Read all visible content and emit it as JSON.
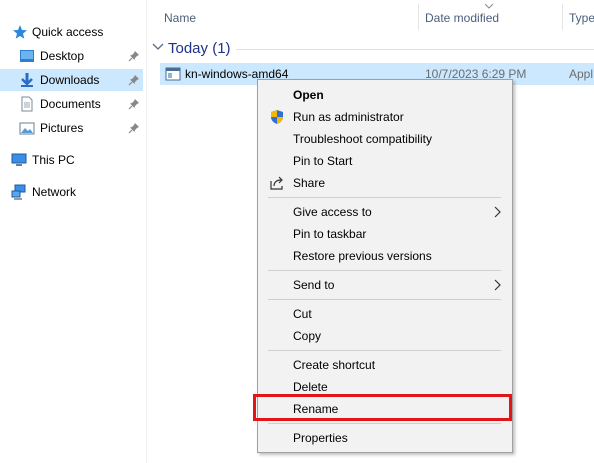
{
  "nav": {
    "items": [
      {
        "label": "Quick access",
        "icon": "star-icon"
      },
      {
        "label": "Desktop",
        "icon": "desktop-folder-icon",
        "pinned": true
      },
      {
        "label": "Downloads",
        "icon": "downloads-folder-icon",
        "pinned": true,
        "selected": true
      },
      {
        "label": "Documents",
        "icon": "documents-folder-icon",
        "pinned": true
      },
      {
        "label": "Pictures",
        "icon": "pictures-folder-icon",
        "pinned": true
      },
      {
        "label": "This PC",
        "icon": "computer-icon"
      },
      {
        "label": "Network",
        "icon": "network-icon"
      }
    ]
  },
  "columns": {
    "name": "Name",
    "date": "Date modified",
    "type": "Type"
  },
  "group": {
    "label": "Today (1)"
  },
  "file": {
    "name": "kn-windows-amd64",
    "date": "10/7/2023 6:29 PM",
    "type": "Appl"
  },
  "context_menu": {
    "items": [
      {
        "label": "Open",
        "bold": true
      },
      {
        "label": "Run as administrator",
        "icon": "uac-shield-icon"
      },
      {
        "label": "Troubleshoot compatibility"
      },
      {
        "label": "Pin to Start"
      },
      {
        "label": "Share",
        "icon": "share-icon"
      },
      {
        "label": "Give access to",
        "submenu": true
      },
      {
        "label": "Pin to taskbar"
      },
      {
        "label": "Restore previous versions"
      },
      {
        "label": "Send to",
        "submenu": true
      },
      {
        "label": "Cut"
      },
      {
        "label": "Copy"
      },
      {
        "label": "Create shortcut"
      },
      {
        "label": "Delete"
      },
      {
        "label": "Rename",
        "highlighted": true
      },
      {
        "label": "Properties"
      }
    ]
  },
  "colors": {
    "selection": "#cce8ff",
    "highlight_border": "#e3151b",
    "group_header": "#1e3287",
    "menu_bg": "#f2f2f2"
  }
}
